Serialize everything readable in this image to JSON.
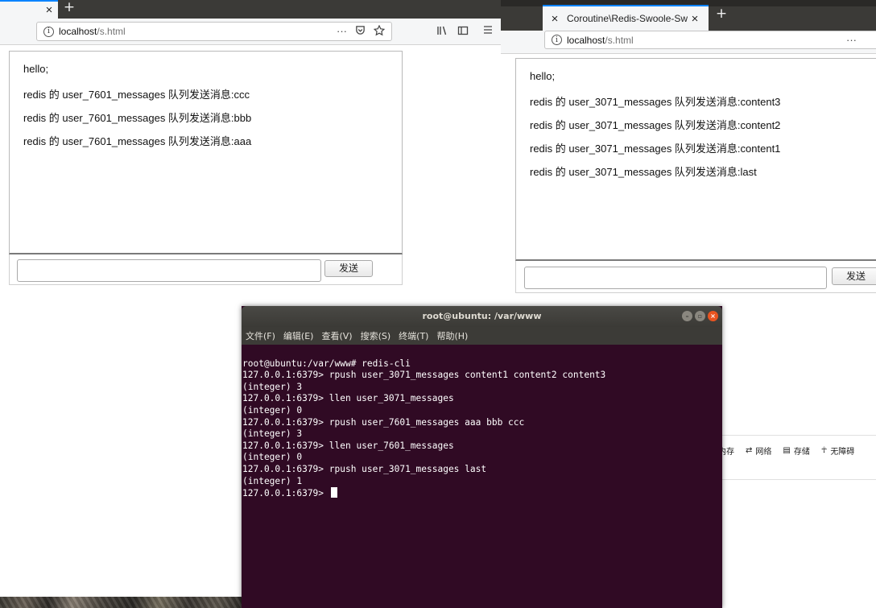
{
  "browser_left": {
    "tab": {
      "close_icon": "×"
    },
    "new_tab_icon": "+",
    "url": {
      "host": "localhost",
      "path": "/s.html"
    },
    "url_right_icons": [
      "···",
      "pocket-icon",
      "star-icon"
    ],
    "toolbar_icons": [
      "library-icon",
      "sidebar-icon",
      "menu-icon"
    ],
    "messages": [
      "hello;",
      "redis 的 user_7601_messages 队列发送消息:ccc",
      "redis 的 user_7601_messages 队列发送消息:bbb",
      "redis 的 user_7601_messages 队列发送消息:aaa"
    ],
    "input_value": "",
    "send_label": "发送"
  },
  "browser_right": {
    "tab": {
      "title": "Coroutine\\Redis-Swoole-Sw",
      "close_icon": "×"
    },
    "new_tab_icon": "+",
    "url": {
      "host": "localhost",
      "path": "/s.html",
      "more": "···"
    },
    "messages": [
      "hello;",
      "redis 的 user_3071_messages 队列发送消息:content3",
      "redis 的 user_3071_messages 队列发送消息:content2",
      "redis 的 user_3071_messages 队列发送消息:content1",
      "redis 的 user_3071_messages 队列发送消息:last"
    ],
    "input_value": "",
    "send_label": "发送",
    "devtools_tabs": [
      "内存",
      "网络",
      "存储",
      "无障碍"
    ]
  },
  "terminal": {
    "title": "root@ubuntu: /var/www",
    "menu": [
      "文件(F)",
      "编辑(E)",
      "查看(V)",
      "搜索(S)",
      "终端(T)",
      "帮助(H)"
    ],
    "lines": [
      "root@ubuntu:/var/www# redis-cli",
      "127.0.0.1:6379> rpush user_3071_messages content1 content2 content3",
      "(integer) 3",
      "127.0.0.1:6379> llen user_3071_messages",
      "(integer) 0",
      "127.0.0.1:6379> rpush user_7601_messages aaa bbb ccc",
      "(integer) 3",
      "127.0.0.1:6379> llen user_7601_messages",
      "(integer) 0",
      "127.0.0.1:6379> rpush user_3071_messages last",
      "(integer) 1"
    ],
    "prompt": "127.0.0.1:6379> "
  },
  "colors": {
    "terminal_bg": "#300a24",
    "ubuntu_orange": "#e95420",
    "firefox_blue": "#0a84ff"
  }
}
